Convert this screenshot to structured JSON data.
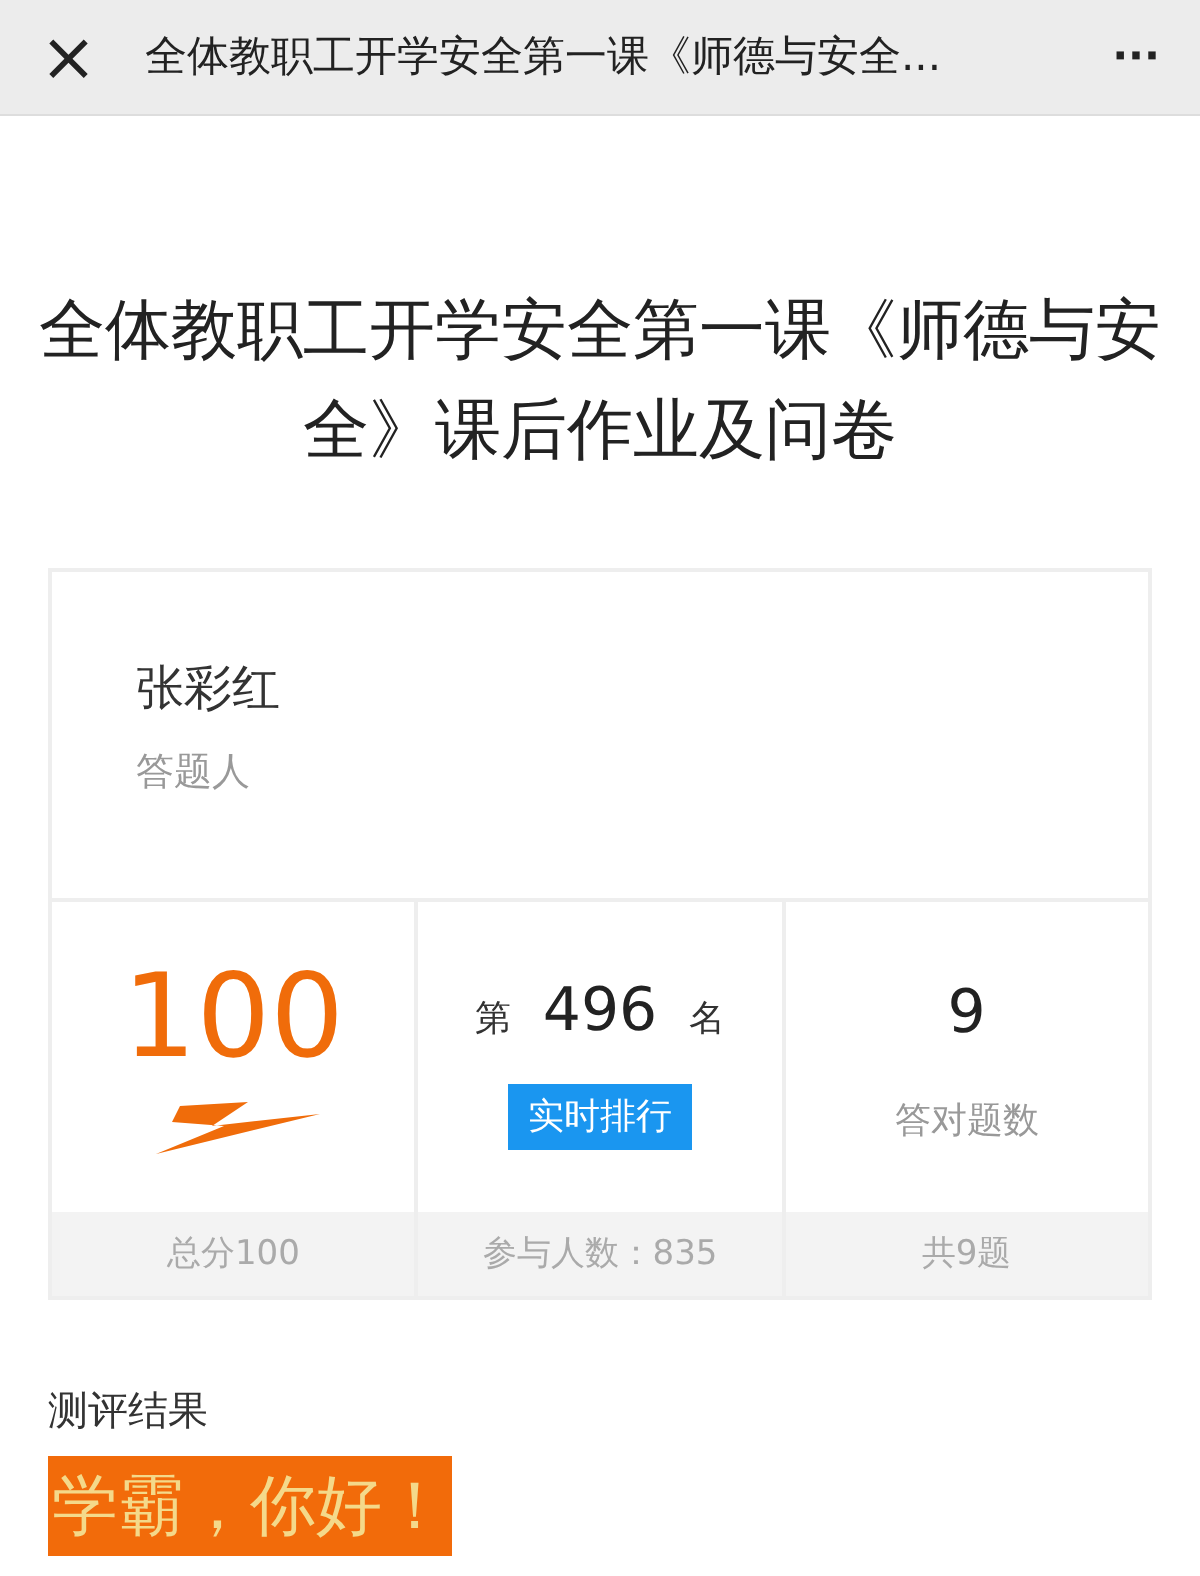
{
  "top_bar": {
    "close": "×",
    "title": "全体教职工开学安全第一课《师德与安全...",
    "more": "···"
  },
  "page_title": "全体教职工开学安全第一课《师德与安全》课后作业及问卷",
  "respondent": {
    "name": "张彩红",
    "label": "答题人"
  },
  "stats": [
    {
      "kind": "score",
      "value": "100",
      "footer": "总分100"
    },
    {
      "kind": "rank",
      "prefix": "第",
      "value": "496",
      "suffix": "名",
      "button": "实时排行",
      "footer": "参与人数：835"
    },
    {
      "kind": "count",
      "value": "9",
      "caption": "答对题数",
      "footer": "共9题"
    }
  ],
  "result": {
    "heading": "测评结果",
    "banner": "学霸，你好！"
  }
}
